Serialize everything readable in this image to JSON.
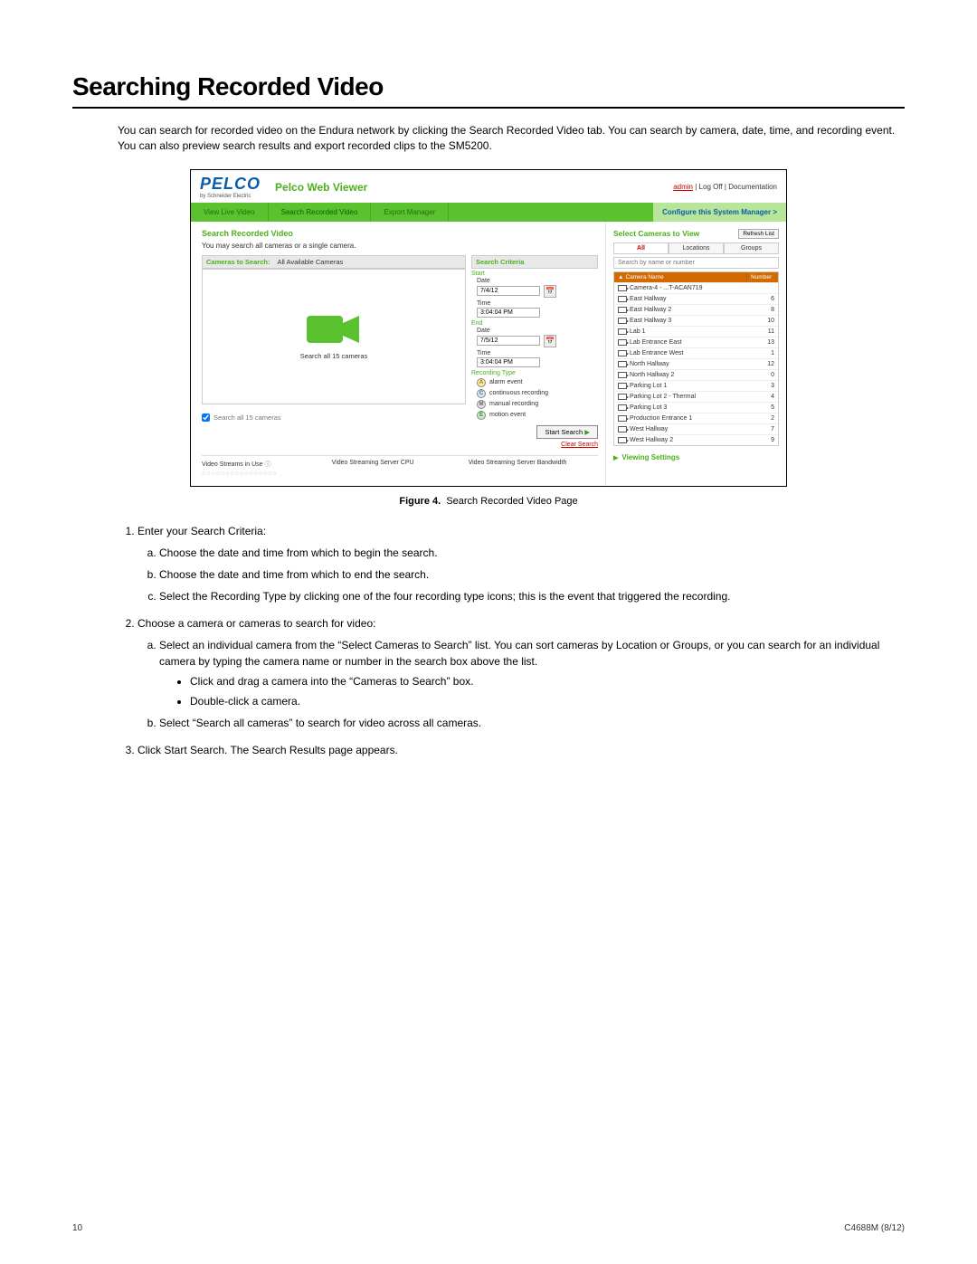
{
  "page": {
    "title": "Searching Recorded Video",
    "intro": "You can search for recorded video on the Endura network by clicking the Search Recorded Video tab. You can search by camera, date, time, and recording event. You can also preview search results and export recorded clips to the SM5200.",
    "figcap_label": "Figure 4.",
    "figcap_text": "Search Recorded Video Page",
    "footer_page": "10",
    "footer_doc": "C4688M (8/12)"
  },
  "screenshot": {
    "logo_brand": "PELCO",
    "logo_sub": "by Schneider Electric",
    "viewer_title": "Pelco Web Viewer",
    "top_user": "admin",
    "top_sep1": " | ",
    "top_logoff": "Log Off",
    "top_sep2": " | ",
    "top_docs": "Documentation",
    "nav": {
      "view_live": "View Live Video",
      "search_rec": "Search Recorded Video",
      "export": "Export Manager",
      "config": "Configure this System Manager >"
    },
    "left": {
      "title": "Search Recorded Video",
      "subnote": "You may search all cameras or a single camera.",
      "cams_label": "Cameras to Search:",
      "cams_value": "All Available Cameras",
      "searchall_caption": "Search all 15 cameras",
      "checkbox_label": "Search all 15 cameras",
      "status_streams": "Video Streams in Use",
      "status_cpu": "Video Streaming Server CPU",
      "status_bw": "Video Streaming Server Bandwidth"
    },
    "criteria": {
      "header": "Search Criteria",
      "start": "Start",
      "end": "End",
      "date_lbl": "Date",
      "time_lbl": "Time",
      "start_date": "7/4/12",
      "start_time": "3:04:04 PM",
      "end_date": "7/5/12",
      "end_time": "3:04:04 PM",
      "rectype": "Recording Type",
      "r_alarm": "alarm event",
      "r_cont": "continuous recording",
      "r_manual": "manual recording",
      "r_motion": "motion event",
      "btn_start": "Start Search",
      "clear": "Clear Search"
    },
    "right": {
      "title": "Select Cameras to View",
      "refresh": "Refresh List",
      "tab_all": "All",
      "tab_loc": "Locations",
      "tab_groups": "Groups",
      "search_ph": "Search by name or number",
      "col_name": "Camera Name",
      "col_num": "Number",
      "rows": [
        {
          "name": "Camera-4 - ...T-ACAN719",
          "num": ""
        },
        {
          "name": "East Hallway",
          "num": "6"
        },
        {
          "name": "East Hallway 2",
          "num": "8"
        },
        {
          "name": "East Hallway 3",
          "num": "10"
        },
        {
          "name": "Lab 1",
          "num": "11"
        },
        {
          "name": "Lab Entrance East",
          "num": "13"
        },
        {
          "name": "Lab Entrance West",
          "num": "1"
        },
        {
          "name": "North Hallway",
          "num": "12"
        },
        {
          "name": "North Hallway 2",
          "num": "0"
        },
        {
          "name": "Parking Lot 1",
          "num": "3"
        },
        {
          "name": "Parking Lot 2 - Thermal",
          "num": "4"
        },
        {
          "name": "Parking Lot 3",
          "num": "5"
        },
        {
          "name": "Production Entrance 1",
          "num": "2"
        },
        {
          "name": "West Hallway",
          "num": "7"
        },
        {
          "name": "West Hallway 2",
          "num": "9"
        }
      ],
      "view_settings": "Viewing Settings"
    }
  },
  "steps": {
    "s1": "Enter your Search Criteria:",
    "s1a": "Choose the date and time from which to begin the search.",
    "s1b": "Choose the date and time from which to end the search.",
    "s1c": "Select the Recording Type by clicking one of the four recording type icons; this is the event that triggered the recording.",
    "s2": "Choose a camera or cameras to search for video:",
    "s2a": "Select an individual camera from the “Select Cameras to Search” list. You can sort cameras by Location or Groups, or you can search for an individual camera by typing the camera name or number in the search box above the list.",
    "s2a_b1": "Click and drag a camera into the “Cameras to Search” box.",
    "s2a_b2": "Double-click a camera.",
    "s2b": "Select “Search all cameras” to search for video across all cameras.",
    "s3": "Click Start Search. The Search Results page appears."
  }
}
